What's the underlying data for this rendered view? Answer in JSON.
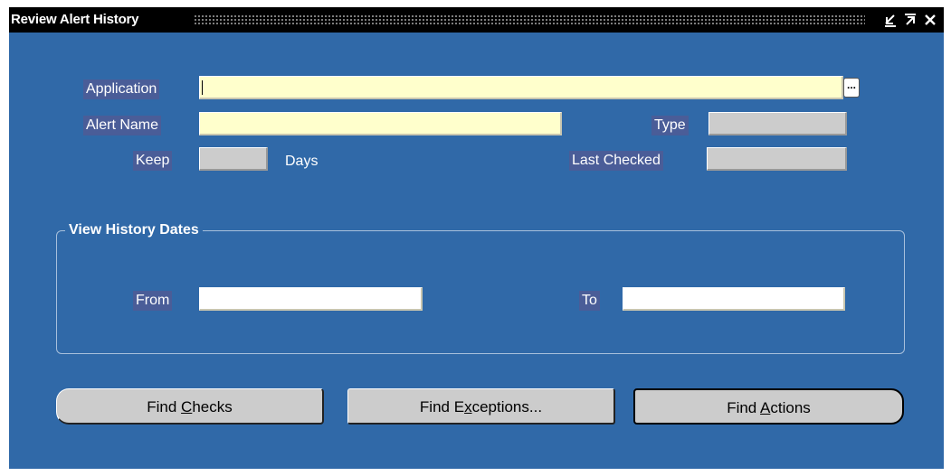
{
  "window": {
    "title": "Review Alert History",
    "controls": {
      "minimize_glyph": "⪝",
      "maximize_glyph": "↗",
      "close_glyph": "✕"
    }
  },
  "form": {
    "application": {
      "label": "Application",
      "value": ""
    },
    "alert_name": {
      "label": "Alert Name",
      "value": ""
    },
    "type": {
      "label": "Type",
      "value": ""
    },
    "keep": {
      "label": "Keep",
      "value": "",
      "unit": "Days"
    },
    "last_checked": {
      "label": "Last Checked",
      "value": ""
    },
    "lov_glyph": "..."
  },
  "history": {
    "title": "View History Dates",
    "from": {
      "label": "From",
      "value": ""
    },
    "to": {
      "label": "To",
      "value": ""
    }
  },
  "buttons": {
    "find_checks": {
      "pre": "Find ",
      "key": "C",
      "post": "hecks"
    },
    "find_exceptions": {
      "pre": "Find E",
      "key": "x",
      "post": "ceptions..."
    },
    "find_actions": {
      "pre": "Find ",
      "key": "A",
      "post": "ctions"
    }
  },
  "colors": {
    "background": "#3069a8",
    "required_field": "#ffffcc",
    "readonly_field": "#cccccc",
    "titlebar": "#000000"
  }
}
